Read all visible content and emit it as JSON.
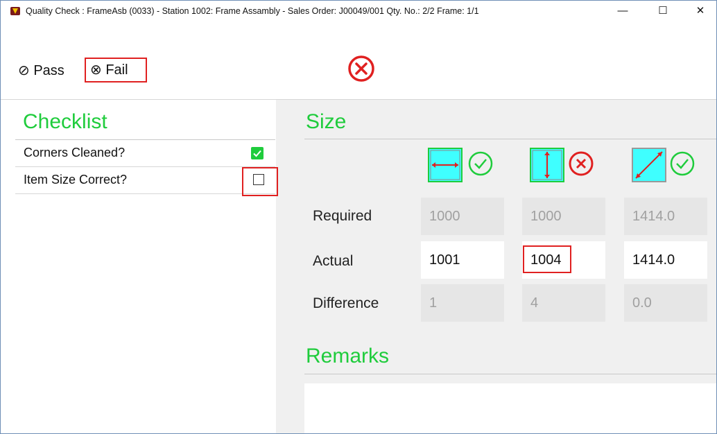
{
  "window": {
    "title": "Quality Check : FrameAsb (0033)  - Station 1002: Frame Assambly - Sales Order: J00049/001  Qty. No.: 2/2  Frame: 1/1",
    "controls": {
      "minimize": "—",
      "maximize": "☐",
      "close": "✕"
    }
  },
  "toolbar": {
    "pass_label": "⊘ Pass",
    "fail_label": "⊗ Fail",
    "status_icon": "fail-circle-x-icon",
    "status_color": "#e02020"
  },
  "checklist": {
    "heading": "Checklist",
    "items": [
      {
        "label": "Corners Cleaned?",
        "checked": true
      },
      {
        "label": "Item Size Correct?",
        "checked": false
      }
    ]
  },
  "size": {
    "heading": "Size",
    "columns": [
      {
        "icon": "width-arrow-icon",
        "status": "pass"
      },
      {
        "icon": "height-arrow-icon",
        "status": "fail"
      },
      {
        "icon": "diagonal-arrow-icon",
        "status": "pass"
      }
    ],
    "rows": {
      "required": {
        "label": "Required",
        "values": [
          "1000",
          "1000",
          "1414.0"
        ]
      },
      "actual": {
        "label": "Actual",
        "values": [
          "1001",
          "1004",
          "1414.0"
        ]
      },
      "difference": {
        "label": "Difference",
        "values": [
          "1",
          "4",
          "0.0"
        ]
      }
    }
  },
  "remarks": {
    "heading": "Remarks",
    "value": ""
  },
  "colors": {
    "accent_green": "#1fcc3c",
    "fail_red": "#e02020",
    "cyan_fill": "#3fffff"
  }
}
